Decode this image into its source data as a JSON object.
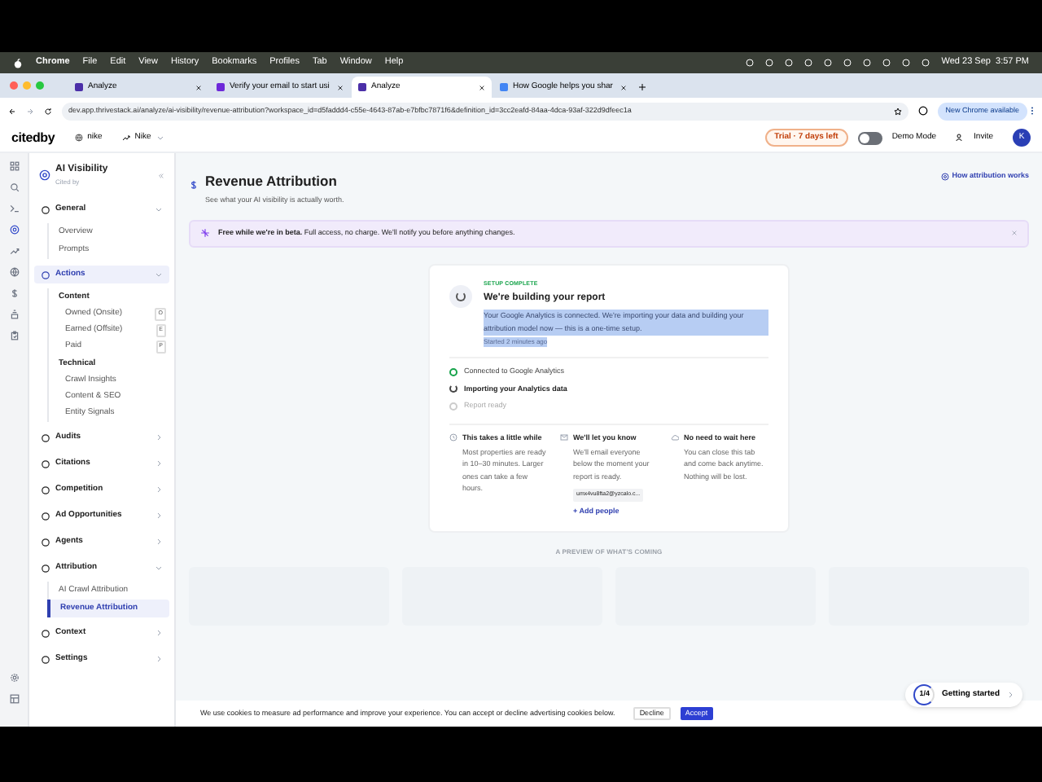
{
  "menu_bar": {
    "app": "Chrome",
    "items": [
      "File",
      "Edit",
      "View",
      "History",
      "Bookmarks",
      "Profiles",
      "Tab",
      "Window",
      "Help"
    ],
    "clock": "Wed 23 Sep  3:57 PM"
  },
  "browser_tabs": [
    {
      "title": "Analyze",
      "color": "#4b2fa8",
      "selected": false
    },
    {
      "title": "Verify your email to start usi",
      "color": "#6d28d9",
      "selected": false
    },
    {
      "title": "Analyze",
      "color": "#4b2fa8",
      "selected": true
    },
    {
      "title": "How Google helps you shar",
      "color": "#4285f4",
      "selected": false
    }
  ],
  "address": "dev.app.thrivestack.ai/analyze/ai-visibility/revenue-attribution?workspace_id=d5faddd4-c55e-4643-87ab-e7bfbc7871f6&definition_id=3cc2eafd-84aa-4dca-93af-322d9dfeec1a",
  "update_button": "New Chrome available",
  "app_header": {
    "logo": "citedby",
    "workspace": "nike",
    "brand": "Nike",
    "trial": "Trial · 7 days left",
    "demo_mode": {
      "label": "Demo Mode",
      "on": false
    },
    "invite": "Invite",
    "avatar": "K"
  },
  "rail_icons": [
    {
      "kind": "grid",
      "selected": false
    },
    {
      "kind": "search",
      "selected": false
    },
    {
      "kind": "terminal",
      "selected": false
    },
    {
      "kind": "target",
      "selected": true
    },
    {
      "kind": "trend",
      "selected": false
    },
    {
      "kind": "globe",
      "selected": false
    },
    {
      "kind": "dollar",
      "selected": false
    },
    {
      "kind": "stack",
      "selected": false
    },
    {
      "kind": "clipboard",
      "selected": false
    }
  ],
  "rail_bottom_icons": [
    {
      "kind": "gear",
      "selected": false
    },
    {
      "kind": "layout",
      "selected": false
    }
  ],
  "sidebar": {
    "title": "AI Visibility",
    "subtitle": "Cited by",
    "items": [
      {
        "label": "General",
        "selected": false,
        "expanded": true,
        "children": [
          {
            "kind": "link",
            "label": "Overview",
            "selected": false
          },
          {
            "kind": "link",
            "label": "Prompts",
            "selected": false
          }
        ]
      },
      {
        "label": "Actions",
        "selected": true,
        "expanded": true,
        "children": [
          {
            "kind": "heading",
            "label": "Content",
            "children": [
              {
                "label": "Owned (Onsite)",
                "badge": "O"
              },
              {
                "label": "Earned (Offsite)",
                "badge": "E"
              },
              {
                "label": "Paid",
                "badge": "P"
              }
            ]
          },
          {
            "kind": "heading",
            "label": "Technical",
            "children": [
              {
                "label": "Crawl Insights"
              },
              {
                "label": "Content & SEO"
              },
              {
                "label": "Entity Signals"
              }
            ]
          }
        ]
      },
      {
        "label": "Audits",
        "selected": false,
        "expanded": false
      },
      {
        "label": "Citations",
        "selected": false,
        "expanded": false
      },
      {
        "label": "Competition",
        "selected": false,
        "expanded": false
      },
      {
        "label": "Ad Opportunities",
        "selected": false,
        "expanded": false
      },
      {
        "label": "Agents",
        "selected": false,
        "expanded": false
      },
      {
        "label": "Attribution",
        "selected": false,
        "expanded": true,
        "children": [
          {
            "kind": "link",
            "label": "AI Crawl Attribution",
            "selected": false
          },
          {
            "kind": "link",
            "label": "Revenue Attribution",
            "selected": true
          }
        ]
      },
      {
        "label": "Context",
        "selected": false,
        "expanded": false
      },
      {
        "label": "Settings",
        "selected": false,
        "expanded": false
      }
    ]
  },
  "page": {
    "title": "Revenue Attribution",
    "subtitle": "See what your AI visibility is actually worth.",
    "help_link": "How attribution works"
  },
  "banner": {
    "text": "**Free while we're in beta.** Full access, no charge. We'll notify you before anything changes."
  },
  "setup_card": {
    "status": "SETUP COMPLETE",
    "title": "We're building your report",
    "description": "Your Google Analytics is connected. We're importing your data and building your attribution model now — this is a one-time setup.",
    "started": "Started 2 minutes ago",
    "highlighted": true,
    "steps": [
      {
        "label": "Connected to Google Analytics",
        "kind": "done"
      },
      {
        "label": "Importing your Analytics data",
        "kind": "active"
      },
      {
        "label": "Report ready",
        "kind": "pending"
      }
    ],
    "info": [
      {
        "kind": "clock",
        "title": "This takes a little while",
        "text": "Most properties are ready in 10–30 minutes. Larger ones can take a few hours."
      },
      {
        "kind": "mail",
        "title": "We'll let you know",
        "text": "We'll email everyone below the moment your report is ready.",
        "email": "umx4vu8fta2@yzcalo.c...",
        "link": "+ Add people"
      },
      {
        "kind": "cloud",
        "title": "No need to wait here",
        "text": "You can close this tab and come back anytime. Nothing will be lost."
      }
    ]
  },
  "preview_label": "A PREVIEW OF WHAT'S COMING",
  "cookie_bar": {
    "text": "We use cookies to measure ad performance and improve your experience. You can accept or decline advertising cookies below.",
    "decline": "Decline",
    "accept": "Accept"
  },
  "getting_started": {
    "progress": "1/4",
    "label": "Getting started"
  }
}
